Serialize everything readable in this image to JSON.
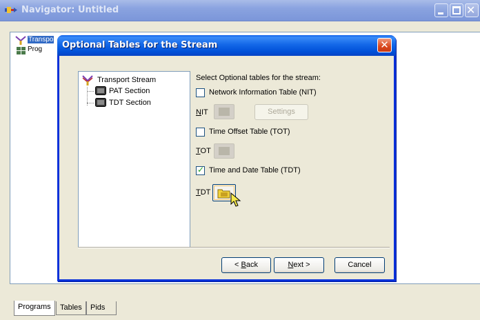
{
  "outer_window": {
    "title": "Navigator: Untitled",
    "tree": {
      "selected_label": "Transpo",
      "child_label": "Prog"
    },
    "bottom_tabs": [
      "Programs",
      "Tables",
      "Pids"
    ]
  },
  "dialog": {
    "title": "Optional Tables for the Stream",
    "tree": {
      "root": "Transport Stream",
      "children": [
        "PAT Section",
        "TDT Section"
      ]
    },
    "prompt": "Select Optional tables for the stream:",
    "options": [
      {
        "label": "Network Information Table (NIT)",
        "checked": false,
        "table_label": "NIT",
        "mnemonic": "N",
        "rest": "IT"
      },
      {
        "label": "Time Offset Table (TOT)",
        "checked": false,
        "table_label": "TOT",
        "mnemonic": "T",
        "rest": "OT"
      },
      {
        "label": "Time and Date Table (TDT)",
        "checked": true,
        "table_label": "TDT",
        "mnemonic": "T",
        "rest": "DT"
      }
    ],
    "settings_label": "Settings",
    "buttons": {
      "back_prefix": "< ",
      "back_mnemonic": "B",
      "back_rest": "ack",
      "next_mnemonic": "N",
      "next_rest": "ext >",
      "cancel": "Cancel"
    }
  },
  "colors": {
    "dialog_title_blue": "#0a5de8",
    "close_red": "#d9461c",
    "selection_blue": "#316ac5",
    "check_green": "#21a121"
  }
}
